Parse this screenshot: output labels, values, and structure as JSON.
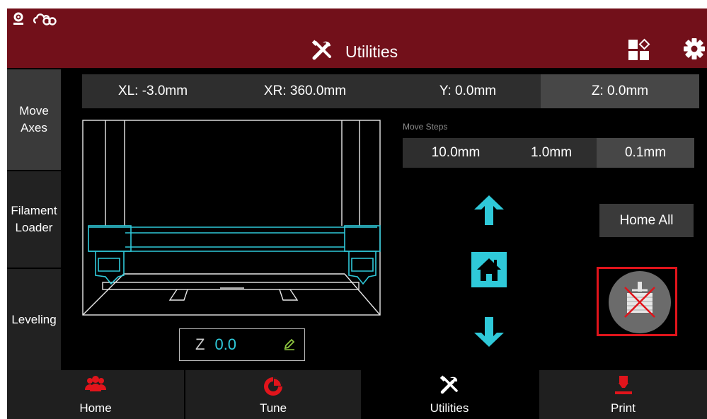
{
  "header": {
    "title": "Utilities",
    "title_icon": "tools-icon",
    "status_icons": [
      "webcam-icon",
      "cloud-link-icon"
    ],
    "actions": [
      "layout-grid-icon",
      "gear-icon"
    ]
  },
  "sidebar": {
    "items": [
      {
        "label_line1": "Move",
        "label_line2": "Axes",
        "active": true
      },
      {
        "label_line1": "Filament",
        "label_line2": "Loader",
        "active": false
      },
      {
        "label_line1": "Leveling",
        "label_line2": "",
        "active": false
      }
    ]
  },
  "coords": {
    "xl": "XL: -3.0mm",
    "xr": "XR: 360.0mm",
    "y": "Y: 0.0mm",
    "z": "Z: 0.0mm",
    "selected": "Z"
  },
  "move_steps": {
    "label": "Move Steps",
    "options": [
      "10.0mm",
      "1.0mm",
      "0.1mm"
    ],
    "selected": "0.1mm"
  },
  "z_display": {
    "label": "Z",
    "value": "0.0"
  },
  "buttons": {
    "home_all": "Home All"
  },
  "bottom_nav": {
    "items": [
      {
        "label": "Home",
        "icon": "users-icon",
        "active": false
      },
      {
        "label": "Tune",
        "icon": "pie-chart-icon",
        "active": false
      },
      {
        "label": "Utilities",
        "icon": "tools-icon",
        "active": true
      },
      {
        "label": "Print",
        "icon": "print-nozzle-icon",
        "active": false
      }
    ]
  },
  "colors": {
    "header": "#72101a",
    "accent": "#2fc9d9",
    "nav_red": "#e1141b",
    "selection_outline": "#e1141b"
  }
}
